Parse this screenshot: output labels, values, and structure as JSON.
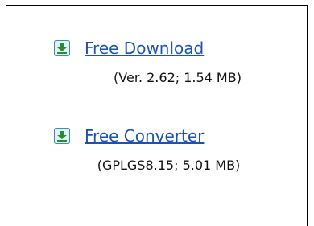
{
  "downloads": [
    {
      "icon": "download-arrow-icon",
      "link_text": "Free Download",
      "details": "(Ver. 2.62; 1.54 MB)"
    },
    {
      "icon": "download-arrow-icon",
      "link_text": "Free Converter",
      "details": "(GPLGS8.15; 5.01 MB)"
    }
  ],
  "colors": {
    "link": "#1a53b4",
    "icon_fill": "#2e8a2e",
    "icon_bg": "#dff3f8",
    "icon_border": "#3f8fa8"
  }
}
